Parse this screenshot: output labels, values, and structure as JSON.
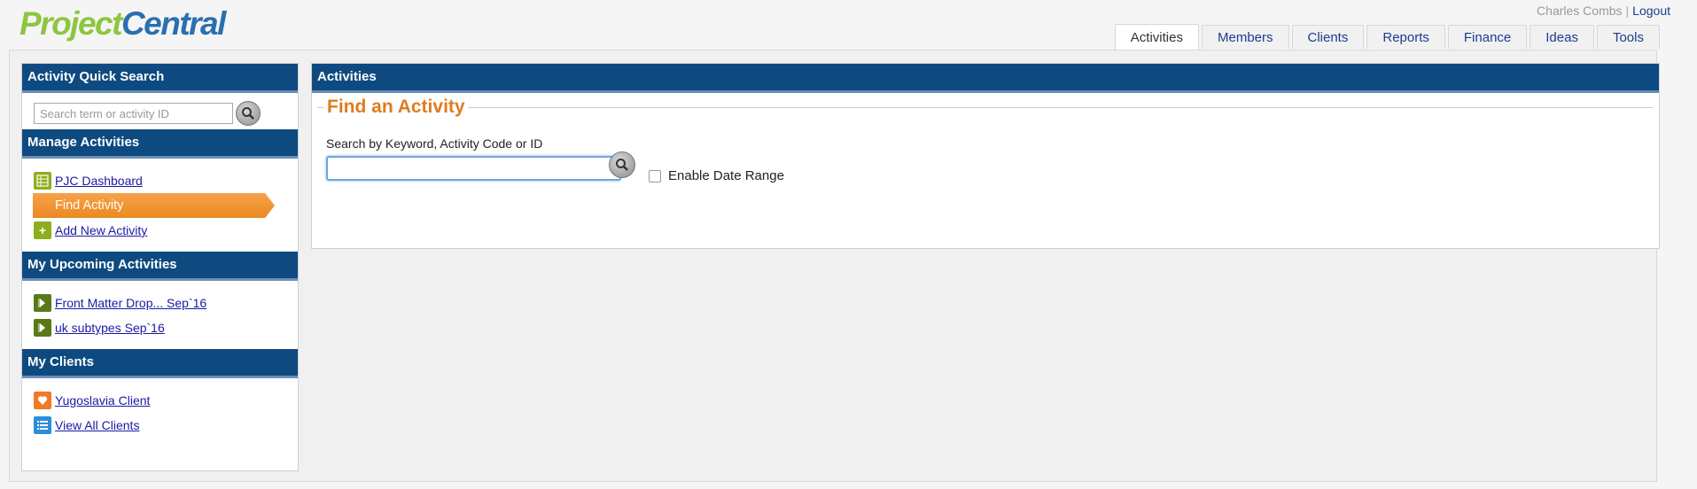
{
  "brand": {
    "part1": "Project",
    "part2": "Central"
  },
  "user": {
    "name": "Charles Combs",
    "separator": "|",
    "logout": "Logout"
  },
  "tabs": [
    {
      "label": "Activities",
      "active": true
    },
    {
      "label": "Members"
    },
    {
      "label": "Clients"
    },
    {
      "label": "Reports"
    },
    {
      "label": "Finance"
    },
    {
      "label": "Ideas"
    },
    {
      "label": "Tools"
    }
  ],
  "sidebar": {
    "quick_search": {
      "title": "Activity Quick Search",
      "placeholder": "Search term or activity ID"
    },
    "manage": {
      "title": "Manage Activities",
      "items": [
        {
          "label": "PJC Dashboard",
          "icon": "list-grid-icon"
        },
        {
          "label": "Find Activity",
          "active": true
        },
        {
          "label": "Add New Activity",
          "icon": "plus-icon"
        }
      ]
    },
    "upcoming": {
      "title": "My Upcoming Activities",
      "items": [
        {
          "label": "Front Matter Drop... Sep`16",
          "icon": "arrow-right-icon"
        },
        {
          "label": "uk subtypes Sep`16",
          "icon": "arrow-right-icon"
        }
      ]
    },
    "clients": {
      "title": "My Clients",
      "items": [
        {
          "label": "Yugoslavia Client",
          "icon": "heart-icon"
        },
        {
          "label": "View All Clients",
          "icon": "list-icon"
        }
      ]
    }
  },
  "main": {
    "header": "Activities",
    "section_title": "Find an Activity",
    "search_label": "Search by Keyword, Activity Code or ID",
    "search_value": "",
    "date_range_label": "Enable Date Range",
    "date_range_checked": false
  },
  "colors": {
    "header_blue": "#0e4a80",
    "accent_orange": "#e07b1f",
    "logo_green": "#8dc63f",
    "logo_blue": "#2a6fb0"
  }
}
